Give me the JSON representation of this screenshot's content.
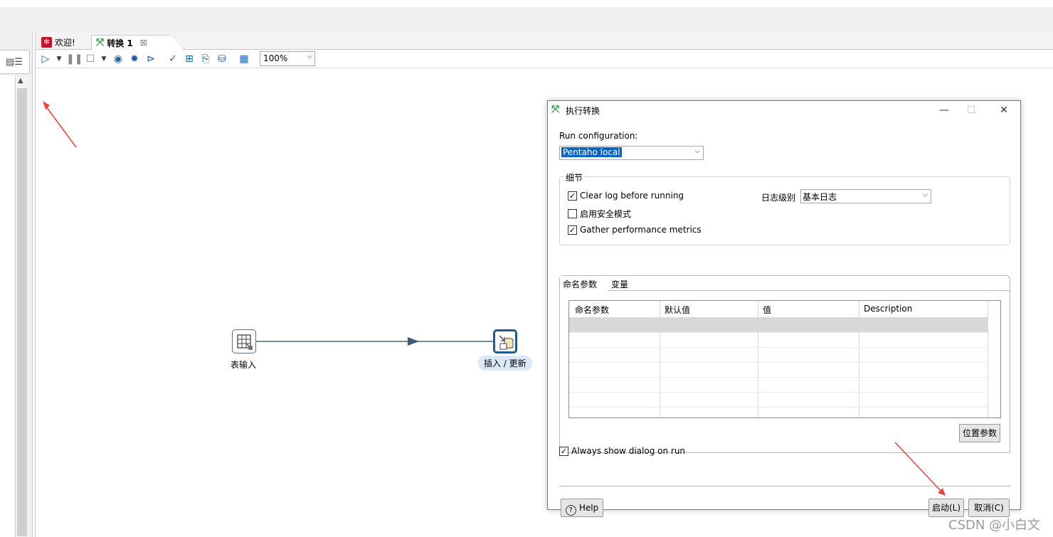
{
  "tabs": [
    {
      "label": "欢迎!"
    },
    {
      "label": "转换 1"
    }
  ],
  "toolbar": {
    "zoom": "100%"
  },
  "canvas": {
    "steps": [
      {
        "label": "表输入"
      },
      {
        "label": "插入 / 更新"
      }
    ]
  },
  "dialog": {
    "title": "执行转换",
    "run_config_label": "Run configuration:",
    "run_config_value": "Pentaho local",
    "details_group": "细节",
    "clear_log": "Clear log before running",
    "safe_mode": "启用安全模式",
    "gather_metrics": "Gather performance metrics",
    "log_level_label": "日志级别",
    "log_level_value": "基本日志",
    "tab_named_params": "命名参数",
    "tab_variables": "变量",
    "columns": [
      "命名参数",
      "默认值",
      "值",
      "Description"
    ],
    "position_params_button": "位置参数",
    "always_show": "Always show dialog on run",
    "help_button": "Help",
    "launch_button": "启动(L)",
    "cancel_button": "取消(C)"
  },
  "watermark": "CSDN @小白文"
}
